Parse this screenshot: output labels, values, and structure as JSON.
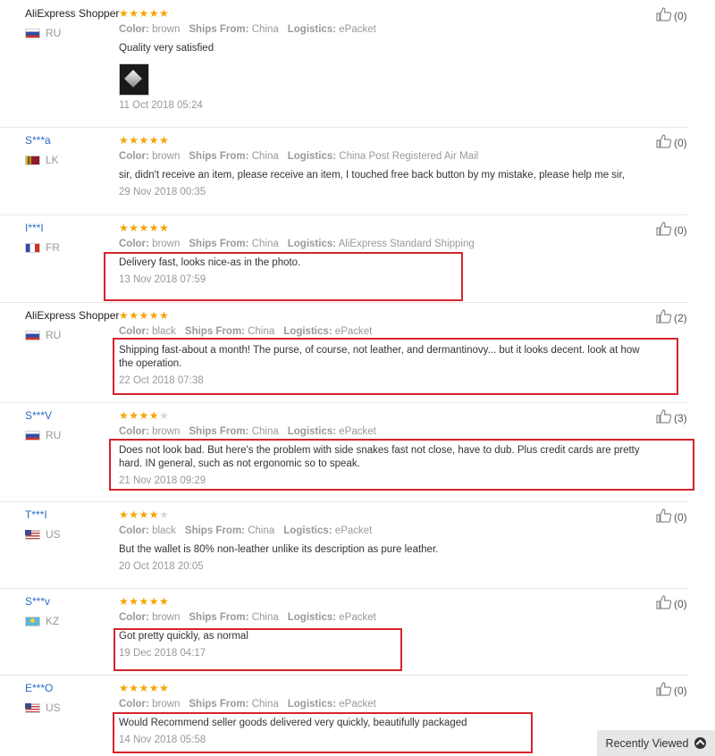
{
  "labels": {
    "color": "Color:",
    "ships_from": "Ships From:",
    "logistics": "Logistics:"
  },
  "reviews": [
    {
      "user": "AliExpress Shopper",
      "country": "RU",
      "flag": "ru",
      "stars": 5,
      "color": "brown",
      "ships_from": "China",
      "logistics": "ePacket",
      "text": "Quality very satisfied",
      "date": "11 Oct 2018 05:24",
      "helpful": "(0)",
      "has_photo": true
    },
    {
      "user": "S***a",
      "country": "LK",
      "flag": "lk",
      "stars": 5,
      "color": "brown",
      "ships_from": "China",
      "logistics": "China Post Registered Air Mail",
      "text": "sir, didn't receive an item, please receive an item, I touched free back button by my mistake, please help me sir,",
      "date": "29 Nov 2018 00:35",
      "helpful": "(0)"
    },
    {
      "user": "I***I",
      "country": "FR",
      "flag": "fr",
      "stars": 5,
      "color": "brown",
      "ships_from": "China",
      "logistics": "AliExpress Standard Shipping",
      "text": "Delivery fast, looks nice-as in the photo.",
      "date": "13 Nov 2018 07:59",
      "helpful": "(0)"
    },
    {
      "user": "AliExpress Shopper",
      "country": "RU",
      "flag": "ru",
      "stars": 5,
      "color": "black",
      "ships_from": "China",
      "logistics": "ePacket",
      "text": "Shipping fast-about a month! The purse, of course, not leather, and dermantinovy... but it looks decent. look at how the operation.",
      "date": "22 Oct 2018 07:38",
      "helpful": "(2)"
    },
    {
      "user": "S***V",
      "country": "RU",
      "flag": "ru",
      "stars": 4,
      "color": "brown",
      "ships_from": "China",
      "logistics": "ePacket",
      "text": "Does not look bad. But here's the problem with side snakes fast not close, have to dub. Plus credit cards are pretty hard. IN general, such as not ergonomic so to speak.",
      "date": "21 Nov 2018 09:29",
      "helpful": "(3)"
    },
    {
      "user": "T***I",
      "country": "US",
      "flag": "us",
      "stars": 4,
      "color": "black",
      "ships_from": "China",
      "logistics": "ePacket",
      "text": "But the wallet is 80% non-leather unlike its description as pure leather.",
      "date": "20 Oct 2018 20:05",
      "helpful": "(0)"
    },
    {
      "user": "S***v",
      "country": "KZ",
      "flag": "kz",
      "stars": 5,
      "color": "brown",
      "ships_from": "China",
      "logistics": "ePacket",
      "text": "Got pretty quickly, as normal",
      "date": "19 Dec 2018 04:17",
      "helpful": "(0)"
    },
    {
      "user": "E***O",
      "country": "US",
      "flag": "us",
      "stars": 5,
      "color": "brown",
      "ships_from": "China",
      "logistics": "ePacket",
      "text": "Would Recommend seller goods delivered very quickly, beautifully packaged",
      "date": "14 Nov 2018 05:58",
      "helpful": "(0)"
    }
  ],
  "recently_viewed": "Recently Viewed",
  "colors": {
    "link": "#2a6bc2",
    "star": "#f5a400",
    "highlight": "#d5232e"
  }
}
